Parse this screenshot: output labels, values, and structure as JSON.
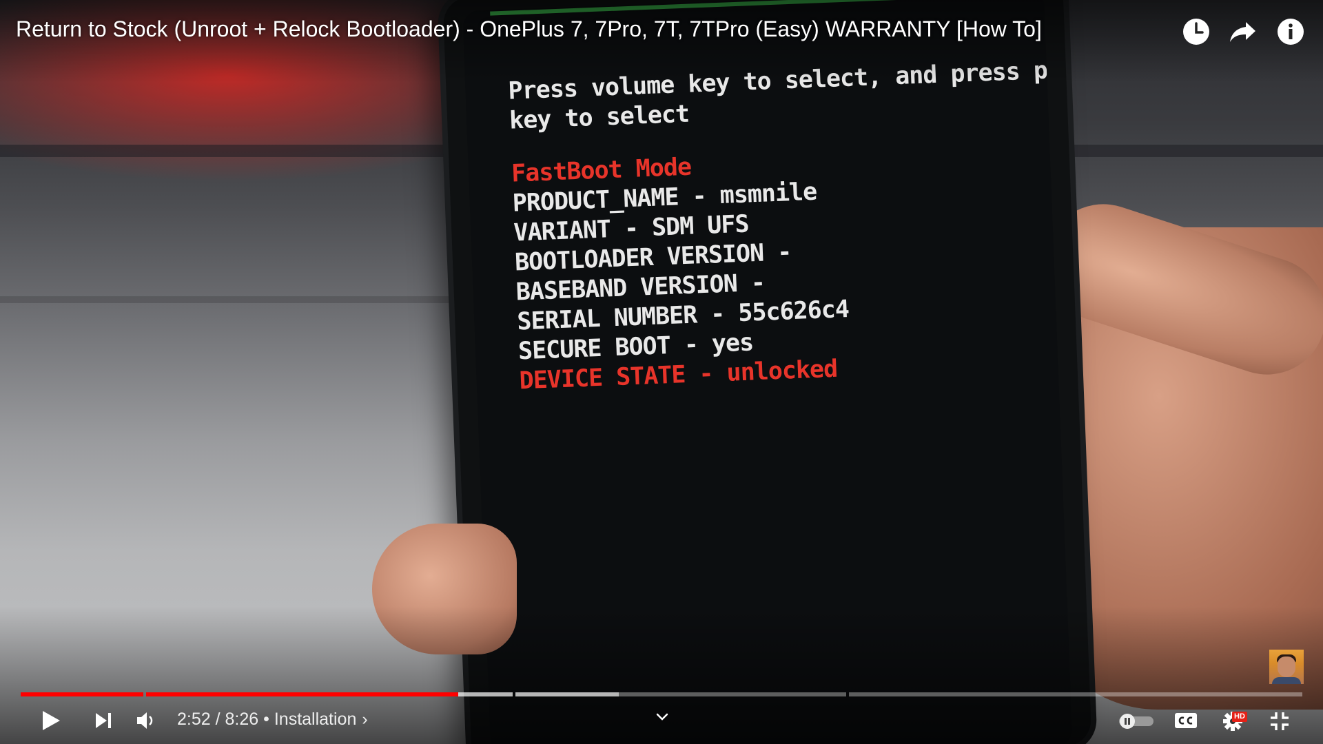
{
  "video": {
    "title": "Return to Stock (Unroot + Relock Bootloader) - OnePlus 7, 7Pro, 7T, 7TPro (Easy) WARRANTY [How To]",
    "progress_fraction": 0.3399,
    "progress_fraction_note_free": true
  },
  "fastboot": {
    "instruction_line1": "Press volume key to select, and press power",
    "instruction_line2": "key to select",
    "mode": "FastBoot Mode",
    "product_name": "PRODUCT_NAME - msmnile",
    "variant": "VARIANT - SDM UFS",
    "bootloader_version": "BOOTLOADER VERSION -",
    "baseband_version": "BASEBAND VERSION -",
    "serial_number": "SERIAL NUMBER - 55c626c4",
    "secure_boot": "SECURE BOOT - yes",
    "device_state": "DEVICE STATE - unlocked"
  },
  "player": {
    "current_time": "2:52",
    "separator": " / ",
    "duration": "8:26",
    "chapter_bullet": " • ",
    "chapter": "Installation",
    "chapter_arrow": "›",
    "hd_badge": "HD"
  },
  "icons": {
    "watch_later": "clock-icon",
    "share": "share-arrow-icon",
    "info": "info-icon",
    "play": "play-icon",
    "next": "next-icon",
    "volume": "volume-icon",
    "chevron": "chevron-down-icon",
    "autoplay": "autoplay-toggle-icon",
    "captions": "cc-icon",
    "settings": "gear-icon",
    "fullscreen_exit": "exit-fullscreen-icon"
  },
  "colors": {
    "progress_played": "#ff0000",
    "fastboot_red": "#e8342a",
    "fastboot_text": "#e9e9e9"
  }
}
